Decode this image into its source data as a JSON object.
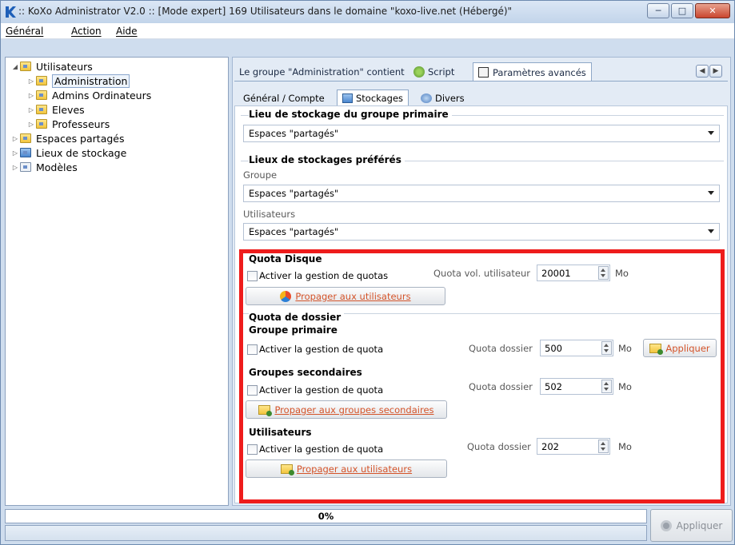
{
  "window": {
    "title": ":: KoXo Administrator V2.0 :: [Mode expert] 169 Utilisateurs dans le domaine \"koxo-live.net (Hébergé)\"",
    "buttons": [
      "minimize",
      "maximize",
      "close"
    ]
  },
  "menu": [
    "Général",
    "Action",
    "Aide"
  ],
  "tree": [
    {
      "label": "Utilisateurs",
      "expanded": true,
      "icon": "folder-icon"
    },
    {
      "label": "Administration",
      "selected": true,
      "icon": "folder-icon"
    },
    {
      "label": "Admins Ordinateurs",
      "icon": "folder-icon"
    },
    {
      "label": "Eleves",
      "icon": "folder-icon"
    },
    {
      "label": "Professeurs",
      "icon": "folder-icon"
    },
    {
      "label": "Espaces partagés",
      "icon": "shared-folder-icon"
    },
    {
      "label": "Lieux de stockage",
      "icon": "storage-icon"
    },
    {
      "label": "Modèles",
      "icon": "template-icon"
    }
  ],
  "tabs": [
    {
      "label": "Le groupe \"Administration\" contient"
    },
    {
      "label": "Script"
    },
    {
      "label": "Paramètres avancés",
      "active": true
    }
  ],
  "subtabs": [
    {
      "label": "Général / Compte"
    },
    {
      "label": "Stockages",
      "active": true
    },
    {
      "label": "Divers"
    }
  ],
  "storage": {
    "primary_title": "Lieu de stockage du groupe primaire",
    "primary_value": "Espaces \"partagés\"",
    "preferred_title": "Lieux de stockages préférés",
    "group_label": "Groupe",
    "group_value": "Espaces \"partagés\"",
    "users_label": "Utilisateurs",
    "users_value": "Espaces \"partagés\""
  },
  "disk_quota": {
    "title": "Quota Disque",
    "checkbox_label": "Activer la gestion de quotas",
    "checked": false,
    "field_label": "Quota vol. utilisateur",
    "value": "20001",
    "unit": "Mo",
    "button": "Propager aux utilisateurs"
  },
  "folder_quota": {
    "title": "Quota de dossier",
    "primary": {
      "title": "Groupe primaire",
      "checkbox_label": "Activer la gestion de quota",
      "checked": false,
      "field_label": "Quota dossier",
      "value": "500",
      "unit": "Mo",
      "button": "Appliquer"
    },
    "secondary": {
      "title": "Groupes secondaires",
      "checkbox_label": "Activer la gestion de quota",
      "checked": false,
      "field_label": "Quota dossier",
      "value": "502",
      "unit": "Mo",
      "button": "Propager aux groupes secondaires"
    },
    "users": {
      "title": "Utilisateurs",
      "checkbox_label": "Activer la gestion de quota",
      "checked": false,
      "field_label": "Quota dossier",
      "value": "202",
      "unit": "Mo",
      "button": "Propager aux utilisateurs"
    }
  },
  "status": {
    "progress_text": "0%",
    "progress": 0,
    "apply_button": "Appliquer"
  },
  "colors": {
    "highlight": "#ee1c1c",
    "link_button_text": "#d4542a"
  }
}
